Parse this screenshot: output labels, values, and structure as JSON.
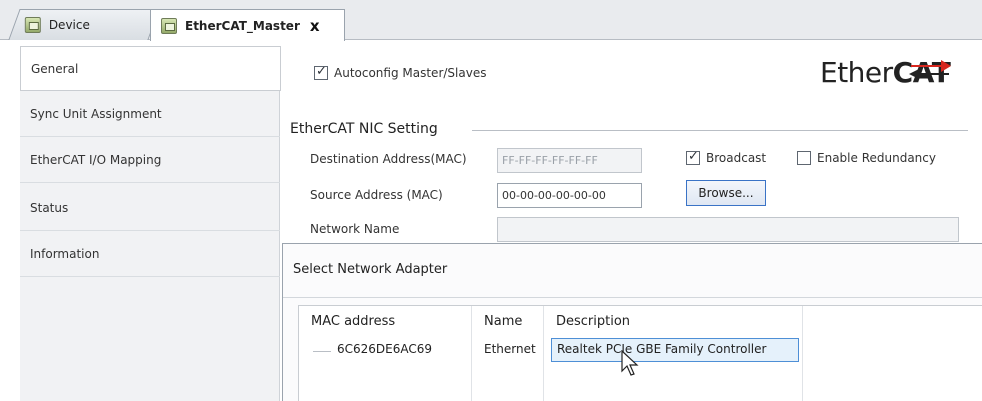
{
  "tabs": [
    {
      "label": "Device"
    },
    {
      "label": "EtherCAT_Master",
      "close": "x"
    }
  ],
  "sidebar": {
    "items": [
      {
        "label": "General"
      },
      {
        "label": "Sync Unit Assignment"
      },
      {
        "label": "EtherCAT I/O Mapping"
      },
      {
        "label": "Status"
      },
      {
        "label": "Information"
      }
    ]
  },
  "general": {
    "autoconfig_label": "Autoconfig Master/Slaves",
    "autoconfig_checked": true,
    "logo": {
      "prefix": "Ether",
      "bold": "CAT"
    },
    "section_title": "EtherCAT NIC Setting",
    "dest_label": "Destination Address(MAC)",
    "dest_value": "FF-FF-FF-FF-FF-FF",
    "broadcast_label": "Broadcast",
    "broadcast_checked": true,
    "redundancy_label": "Enable Redundancy",
    "redundancy_checked": false,
    "source_label": "Source Address (MAC)",
    "source_value": "00-00-00-00-00-00",
    "browse_label": "Browse...",
    "network_label": "Network Name",
    "network_value": ""
  },
  "dialog": {
    "title": "Select Network Adapter",
    "columns": [
      "MAC address",
      "Name",
      "Description"
    ],
    "rows": [
      {
        "mac": "6C626DE6AC69",
        "name": "Ethernet",
        "description": "Realtek PCIe GBE Family Controller",
        "selected": true
      }
    ]
  },
  "colors": {
    "accent": "#4e8fd6",
    "selection_bg": "#e5f1fb",
    "logo_arrow": "#d7261e"
  }
}
